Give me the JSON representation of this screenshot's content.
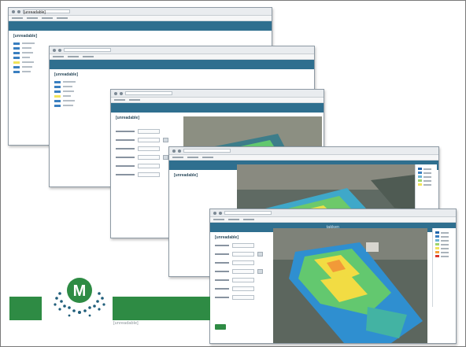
{
  "windows": [
    {
      "tab": "[unreadable]",
      "title": "[unreadable]"
    },
    {
      "title": "[unreadable]"
    },
    {
      "title": "[unreadable]"
    },
    {
      "title": "[unreadable]"
    },
    {
      "title": "[unreadable]",
      "header": "takken"
    }
  ],
  "legend_colors": [
    "#2166ac",
    "#3a7fc0",
    "#6bb5d6",
    "#9ed46f",
    "#f1e35a",
    "#f4a13a",
    "#d9392e"
  ],
  "field_colors": {
    "low": "#2f8fd0",
    "mid": "#63c86f",
    "high": "#f2dc43",
    "peak": "#f29a38"
  },
  "brand": {
    "green": "#2e8b44",
    "blue": "#2f6f8f",
    "logo_letter": "M"
  },
  "footer_caption": "[unreadable]"
}
